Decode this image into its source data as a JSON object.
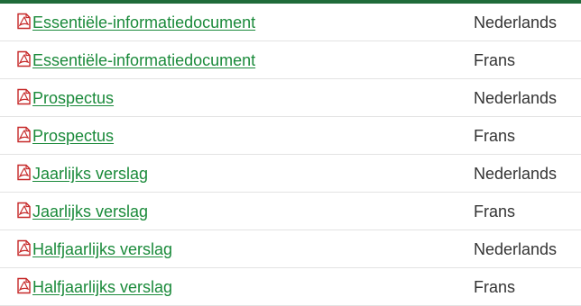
{
  "colors": {
    "accent": "#1f6b3a",
    "link": "#1a8a3a",
    "text": "#333333",
    "pdf_icon": "#c62828"
  },
  "documents": [
    {
      "icon": "pdf-icon",
      "title": "Essentiële-informatiedocument",
      "language": "Nederlands"
    },
    {
      "icon": "pdf-icon",
      "title": "Essentiële-informatiedocument",
      "language": "Frans"
    },
    {
      "icon": "pdf-icon",
      "title": "Prospectus",
      "language": "Nederlands"
    },
    {
      "icon": "pdf-icon",
      "title": "Prospectus",
      "language": "Frans"
    },
    {
      "icon": "pdf-icon",
      "title": "Jaarlijks verslag",
      "language": "Nederlands"
    },
    {
      "icon": "pdf-icon",
      "title": "Jaarlijks verslag",
      "language": "Frans"
    },
    {
      "icon": "pdf-icon",
      "title": "Halfjaarlijks verslag",
      "language": "Nederlands"
    },
    {
      "icon": "pdf-icon",
      "title": "Halfjaarlijks verslag",
      "language": "Frans"
    }
  ]
}
